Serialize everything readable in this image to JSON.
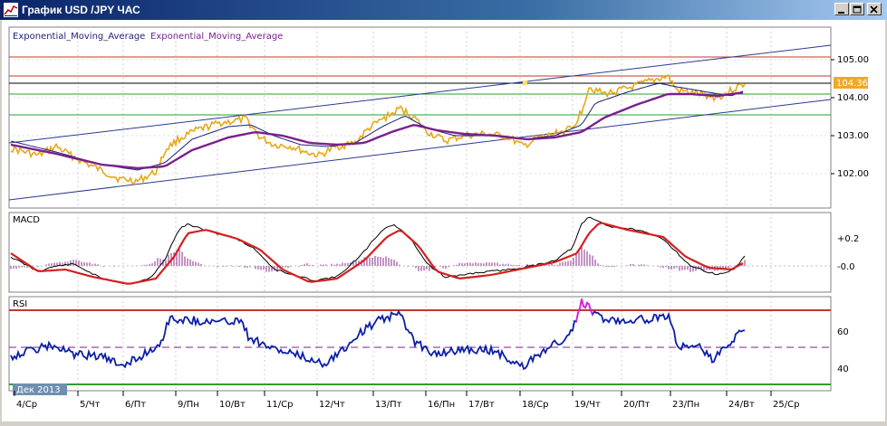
{
  "window": {
    "title": "График USD /JPY ЧАС"
  },
  "price_panel": {
    "indicator_label_1": "Exponential_Moving_Average",
    "indicator_label_2": "Exponential_Moving_Average",
    "current_price": "104.36",
    "axis_ticks": [
      "105.00",
      "104.00",
      "103.00",
      "102.00"
    ]
  },
  "macd_panel": {
    "label": "MACD",
    "axis_ticks": [
      "+0.2",
      "-0.0"
    ]
  },
  "rsi_panel": {
    "label": "RSI",
    "axis_ticks": [
      "60",
      "40"
    ]
  },
  "time_axis": {
    "period_badge": "Дек 2013",
    "labels": [
      "4/Ср",
      "5/Чт",
      "6/Пт",
      "9/Пн",
      "10/Вт",
      "11/Ср",
      "12/Чт",
      "13/Пт",
      "16/Пн",
      "17/Вт",
      "18/Ср",
      "19/Чт",
      "20/Пт",
      "23/Пн",
      "24/Вт",
      "25/Ср"
    ]
  },
  "colors": {
    "price": "#e6a817",
    "ema_fast": "#1f1f7a",
    "ema_slow": "#7a1f8f",
    "channel": "#2b3a8f",
    "resistance": "#c0392b",
    "support": "#2e9e2e",
    "macd_line": "#000000",
    "macd_signal": "#d42020",
    "macd_hist": "#8b2a8b",
    "rsi_line": "#0b1fa8",
    "rsi_overbought": "#e020e0"
  }
}
